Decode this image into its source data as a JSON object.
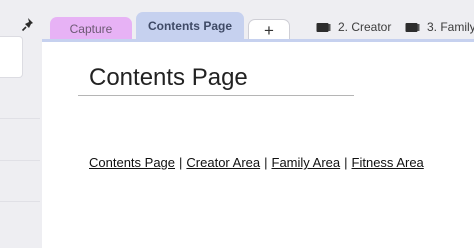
{
  "tabs": {
    "capture_label": "Capture",
    "contents_label": "Contents Page",
    "add_label": "+"
  },
  "sections": [
    {
      "label": "2. Creator",
      "icon": "notebook-icon"
    },
    {
      "label": "3. Family",
      "icon": "notebook-icon"
    }
  ],
  "page": {
    "title": "Contents Page",
    "links": [
      {
        "label": "Contents Page"
      },
      {
        "label": "Creator Area"
      },
      {
        "label": "Family Area"
      },
      {
        "label": "Fitness Area"
      }
    ],
    "separator": "|"
  },
  "colors": {
    "capture_tab": "#e7b2f5",
    "active_tab": "#c6d1ef",
    "page_background": "#ffffff",
    "app_background": "#eeeef2"
  }
}
